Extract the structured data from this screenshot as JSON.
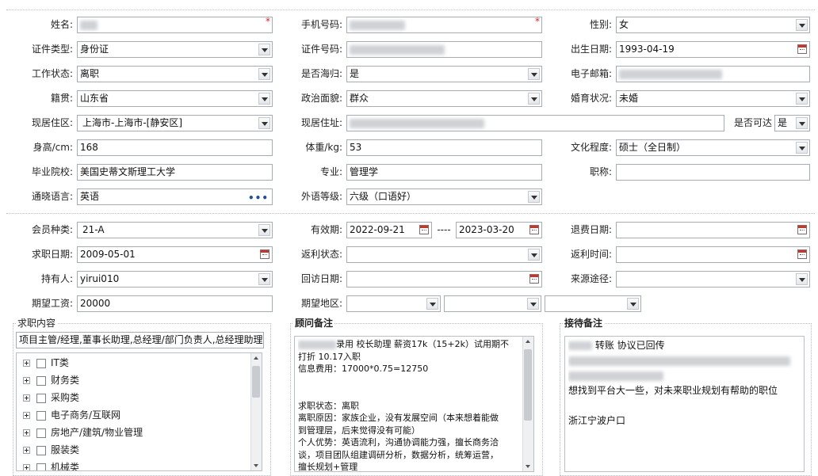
{
  "fields": {
    "name": {
      "label": "姓名:",
      "required": "*"
    },
    "phone": {
      "label": "手机号码:",
      "required": "*"
    },
    "gender": {
      "label": "性别:",
      "value": "女"
    },
    "id_type": {
      "label": "证件类型:",
      "value": "身份证"
    },
    "id_number": {
      "label": "证件号码:"
    },
    "birth_date": {
      "label": "出生日期:",
      "value": "1993-04-19"
    },
    "work_status": {
      "label": "工作状态:",
      "value": "离职"
    },
    "returnee": {
      "label": "是否海归:",
      "value": "是"
    },
    "email": {
      "label": "电子邮箱:"
    },
    "native_place": {
      "label": "籍贯:",
      "value": "山东省"
    },
    "political": {
      "label": "政治面貌:",
      "value": "群众"
    },
    "marital": {
      "label": "婚育状况:",
      "value": "未婚"
    },
    "residence": {
      "label": "现居住区:",
      "value": "上海市-上海市-[静安区]"
    },
    "address": {
      "label": "现居住址:"
    },
    "reachable": {
      "label": "是否可达",
      "value": "是"
    },
    "height": {
      "label": "身高/cm:",
      "value": "168"
    },
    "weight": {
      "label": "体重/kg:",
      "value": "53"
    },
    "education": {
      "label": "文化程度:",
      "value": "硕士（全日制）"
    },
    "school": {
      "label": "毕业院校:",
      "value": "美国史蒂文斯理工大学"
    },
    "major": {
      "label": "专业:",
      "value": "管理学"
    },
    "title": {
      "label": "职称:",
      "value": ""
    },
    "language": {
      "label": "通晓语言:",
      "value": "英语",
      "more": "•••"
    },
    "language_level": {
      "label": "外语等级:",
      "value": "六级（口语好）"
    }
  },
  "membership": {
    "member_type": {
      "label": "会员种类:",
      "value": "21-A"
    },
    "validity": {
      "label": "有效期:",
      "start": "2022-09-21",
      "sep": "----",
      "end": "2023-03-20"
    },
    "refund_date": {
      "label": "退费日期:",
      "value": ""
    },
    "job_seek_date": {
      "label": "求职日期:",
      "value": "2009-05-01"
    },
    "rebate_status": {
      "label": "返利状态:",
      "value": ""
    },
    "rebate_time": {
      "label": "返利时间:",
      "value": ""
    },
    "holder": {
      "label": "持有人:",
      "value": "yirui010"
    },
    "visit_date": {
      "label": "回访日期:",
      "value": ""
    },
    "source": {
      "label": "来源途径:",
      "value": ""
    },
    "expected_salary": {
      "label": "期望工资:",
      "value": "20000"
    },
    "expected_region": {
      "label": "期望地区:"
    }
  },
  "job_content": {
    "title": "求职内容",
    "summary": "项目主管/经理,董事长助理,总经理/部门负责人,总经理助理",
    "categories": [
      "IT类",
      "财务类",
      "采购类",
      "电子商务/互联网",
      "房地产/建筑/物业管理",
      "服装类",
      "机械类"
    ]
  },
  "advisor_notes": {
    "title": "顾问备注",
    "lines": [
      "录用 校长助理 薪资17k（15+2k）试用期不",
      "打折   10.17入职",
      "信息费用：17000*0.75=12750",
      "",
      "",
      "求职状态：离职",
      "离职原因：家族企业，没有发展空间（本来想着能做",
      "到管理层，后来觉得没有可能）",
      "个人优势：英语流利，沟通协调能力强，擅长商务洽",
      "谈，项目团队组建调研分析，数据分析，统筹运营，",
      "擅长规划+管理"
    ]
  },
  "reception_notes": {
    "title": "接待备注",
    "lines": [
      "转账 协议已回传",
      "",
      "",
      "想找到平台大一些，对未来职业规划有帮助的职位",
      "",
      "浙江宁波户口"
    ]
  }
}
